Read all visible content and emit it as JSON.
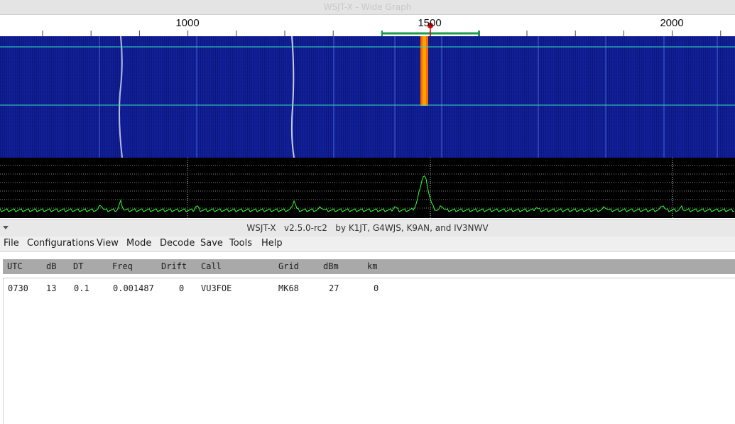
{
  "wide_graph": {
    "title": "WSJT-X - Wide Graph",
    "scale_labels": [
      "1000",
      "1500",
      "2000"
    ]
  },
  "main_window": {
    "title": "WSJT-X   v2.5.0-rc2   by K1JT, G4WJS, K9AN, and IV3NWV"
  },
  "menu": [
    "File",
    "Configurations",
    "View",
    "Mode",
    "Decode",
    "Save",
    "Tools",
    "Help"
  ],
  "table": {
    "columns": [
      "UTC",
      "dB",
      "DT",
      "Freq",
      "Drift",
      "Call",
      "Grid",
      "dBm",
      "km"
    ],
    "rows": [
      [
        "0730",
        "13",
        "0.1",
        "0.001487",
        "0",
        "VU3FOE",
        "MK68",
        "27",
        "0"
      ]
    ]
  },
  "colors": {
    "waterfall_bg": "#0d1c94",
    "signal": "#ff6a00",
    "spectrum_line": "#33ff33",
    "marker_green": "#1a9a4a",
    "marker_red": "#e00000",
    "cyan_line": "#30e0b0",
    "header_bg": "#a9a9a9"
  }
}
